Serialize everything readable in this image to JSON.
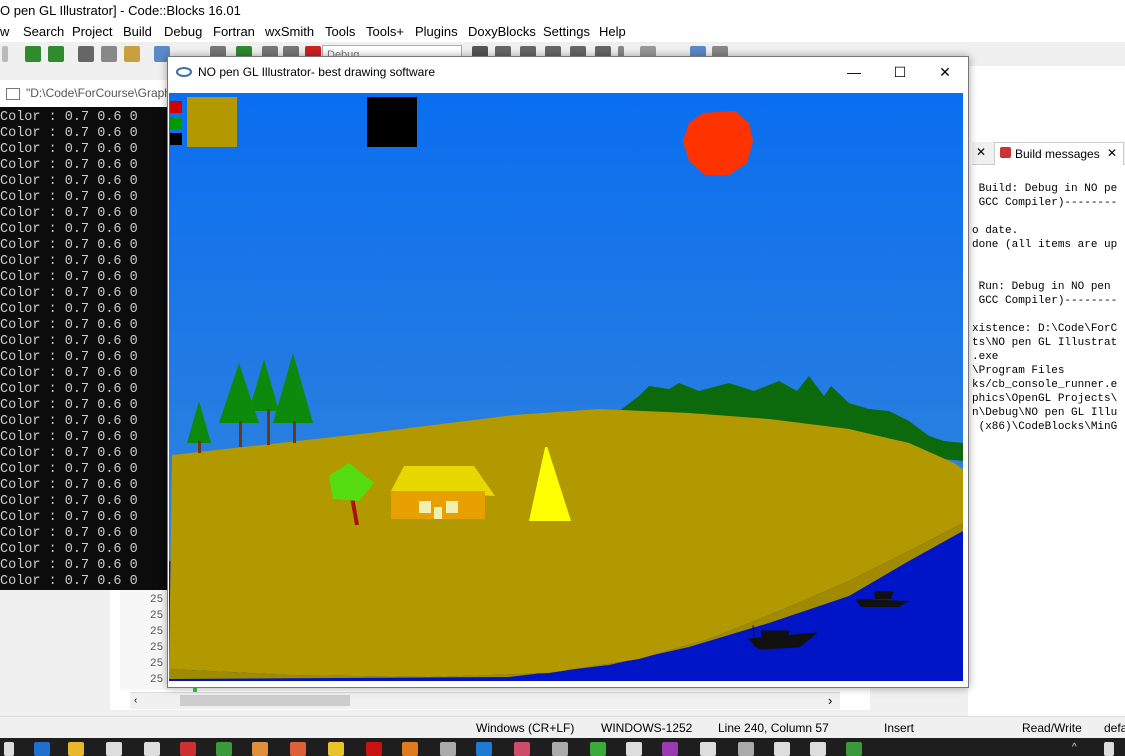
{
  "ide": {
    "title": "O pen GL Illustrator] - Code::Blocks 16.01",
    "menu": [
      "w",
      "Search",
      "Project",
      "Build",
      "Debug",
      "Fortran",
      "wxSmith",
      "Tools",
      "Tools+",
      "Plugins",
      "DoxyBlocks",
      "Settings",
      "Help"
    ],
    "build_target": "Debug"
  },
  "console": {
    "title": "\"D:\\Code\\ForCourse\\Graph",
    "line_text": "Color : 0.7 0.6 0",
    "line_count": 30
  },
  "editor": {
    "line_numbers": [
      "25",
      "25",
      "25",
      "25",
      "25",
      "25"
    ]
  },
  "logs": {
    "tab_label": "Build messages",
    "lines": [
      " Build: Debug in NO pe",
      " GCC Compiler)--------",
      "",
      "o date.",
      "done (all items are up",
      "",
      "",
      " Run: Debug in NO pen",
      " GCC Compiler)--------",
      "",
      "xistence: D:\\Code\\ForC",
      "ts\\NO pen GL Illustrat",
      ".exe",
      "\\Program Files",
      "ks/cb_console_runner.e",
      "phics\\OpenGL Projects\\",
      "n\\Debug\\NO pen GL Illu",
      " (x86)\\CodeBlocks\\MinG"
    ]
  },
  "status": {
    "eol": "Windows (CR+LF)",
    "encoding": "WINDOWS-1252",
    "position": "Line 240, Column 57",
    "mode": "Insert",
    "access": "Read/Write",
    "extra": "defa"
  },
  "gl_window": {
    "title": "NO pen GL Illustrator- best drawing software",
    "controls": {
      "minimize": "—",
      "maximize": "☐",
      "close": "✕"
    },
    "palette_colors": [
      "#cc0000",
      "#009900",
      "#000000"
    ],
    "selected_color": "#b39900",
    "scene": {
      "sky_top": "#0a6ef0",
      "sky_bottom": "#3a88d8",
      "sun_color": "#ff3300",
      "land_color": "#b39900",
      "water_color": "#0014c8",
      "tree_color": "#0c8a0c",
      "hut_color": "#e8d800",
      "tent_color": "#ffff00"
    }
  }
}
